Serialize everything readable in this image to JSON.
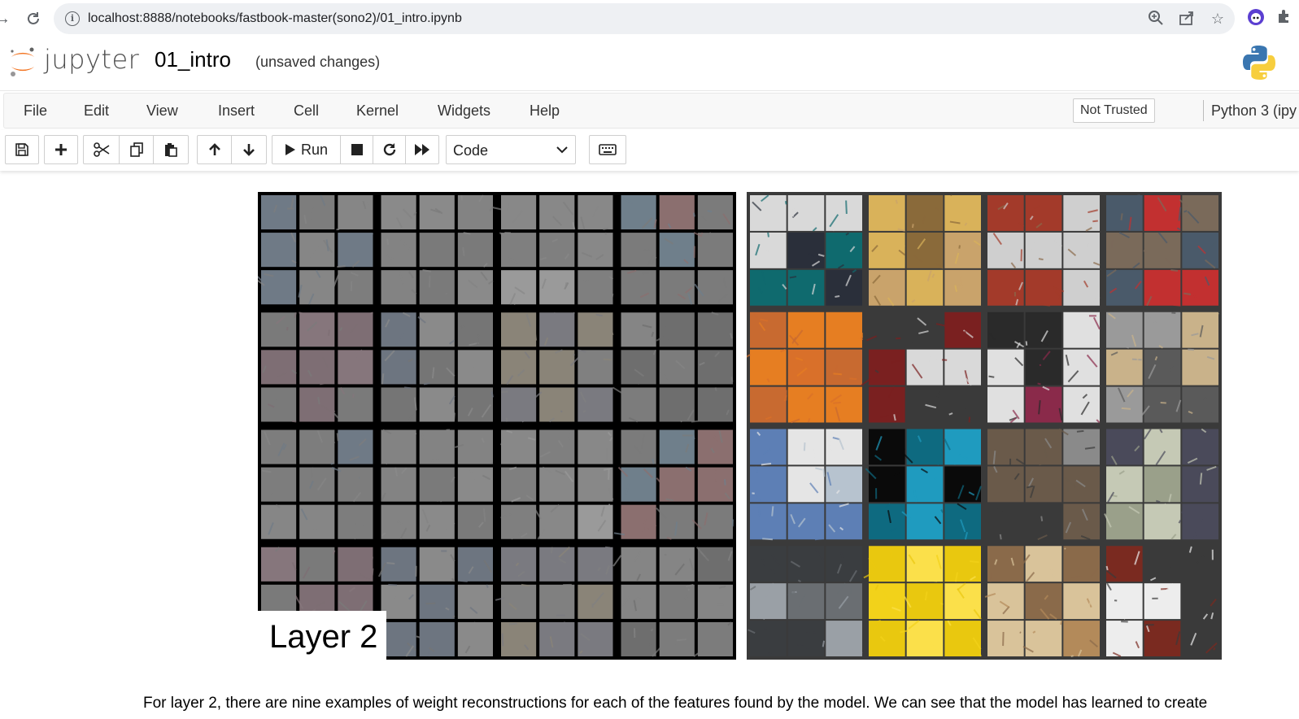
{
  "browser": {
    "url": "localhost:8888/notebooks/fastbook-master(sono2)/01_intro.ipynb"
  },
  "header": {
    "logo_text": "jupyter",
    "notebook_title": "01_intro",
    "save_status": "(unsaved changes)"
  },
  "menubar": {
    "items": [
      "File",
      "Edit",
      "View",
      "Insert",
      "Cell",
      "Kernel",
      "Widgets",
      "Help"
    ],
    "trust_label": "Not Trusted",
    "kernel_label": "Python 3 (ipy"
  },
  "toolbar": {
    "run_label": "Run",
    "cell_type": "Code"
  },
  "figure": {
    "label": "Layer 2"
  },
  "content": {
    "paragraph": "For layer 2, there are nine examples of weight reconstructions for each of the features found by the model. We can see that the model has learned to create"
  },
  "colors": {
    "jupyter_orange": "#f37726",
    "menubar_bg": "#f8f8f8",
    "omnibox_bg": "#eef0f3"
  }
}
